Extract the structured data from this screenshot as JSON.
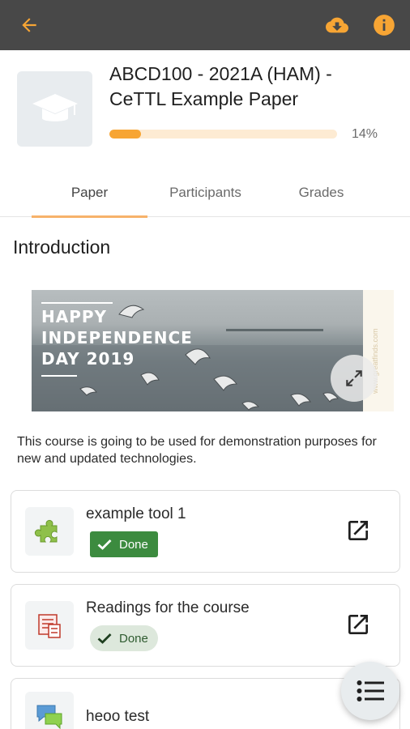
{
  "topbar": {
    "back_icon": "arrow-back-icon",
    "download_icon": "cloud-download-icon",
    "info_icon": "info-icon",
    "accent": "#f7a534"
  },
  "course": {
    "title": "ABCD100 - 2021A (HAM) - CeTTL Example Paper",
    "progress_percent": 14,
    "progress_label": "14%"
  },
  "tabs": [
    {
      "label": "Paper",
      "active": true
    },
    {
      "label": "Participants",
      "active": false
    },
    {
      "label": "Grades",
      "active": false
    }
  ],
  "section": {
    "title": "Introduction",
    "banner_text": [
      "HAPPY",
      "INDEPENDENCE",
      "DAY 2019"
    ],
    "banner_side_text": "www.greatfinds.com",
    "description": "This course is going to be used for demonstration purposes for new and updated technologies."
  },
  "activities": [
    {
      "name": "example tool 1",
      "status": "Done",
      "icon": "puzzle-icon",
      "style": "dark"
    },
    {
      "name": "Readings for the course",
      "status": "Done",
      "icon": "book-icon",
      "style": "light"
    },
    {
      "name": "heoo test",
      "status": "",
      "icon": "chat-icon",
      "style": "none"
    }
  ],
  "fab": {
    "icon": "list-icon"
  }
}
